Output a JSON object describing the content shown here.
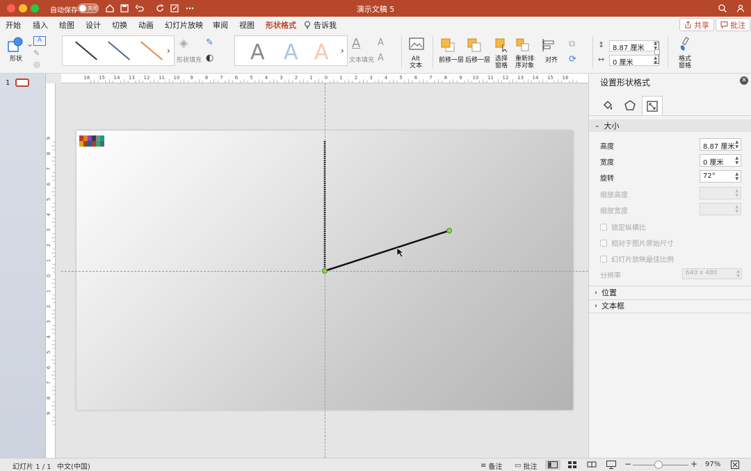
{
  "window": {
    "title": "演示文稿 5",
    "autosave_label": "自动保存",
    "autosave_state": "关闭"
  },
  "tabs": [
    "开始",
    "插入",
    "绘图",
    "设计",
    "切换",
    "动画",
    "幻灯片放映",
    "审阅",
    "视图",
    "形状格式",
    "告诉我"
  ],
  "active_tab": "形状格式",
  "share_label": "共享",
  "comment_label": "批注",
  "ribbon": {
    "shape_label": "形状",
    "shape_fill_label": "形状填充",
    "text_fill_label": "文本填充",
    "wordart_letter": "A",
    "alt_text_label": "Alt\n文本",
    "bring_forward_label": "前移一层",
    "send_backward_label": "后移一层",
    "selection_pane_label": "选择\n窗格",
    "reorder_label": "重新排\n序对象",
    "align_label": "对齐",
    "height_value": "8.87 厘米",
    "width_value": "0 厘米",
    "format_pane_label": "格式\n窗格"
  },
  "thumbnails": {
    "slide_number": "1"
  },
  "ruler": {
    "h_ticks": [
      "16",
      "15",
      "14",
      "13",
      "12",
      "11",
      "10",
      "9",
      "8",
      "7",
      "6",
      "5",
      "4",
      "3",
      "2",
      "1",
      "0",
      "1",
      "2",
      "3",
      "4",
      "5",
      "6",
      "7",
      "8",
      "9",
      "10",
      "11",
      "12",
      "13",
      "14",
      "15",
      "16"
    ],
    "v_ticks": [
      "9",
      "8",
      "7",
      "6",
      "5",
      "4",
      "3",
      "2",
      "1",
      "0",
      "1",
      "2",
      "3",
      "4",
      "5",
      "6",
      "7",
      "8",
      "9"
    ]
  },
  "format_panel": {
    "title": "设置形状格式",
    "size_section": "大小",
    "height_label": "高度",
    "height_value": "8.87 厘米",
    "width_label": "宽度",
    "width_value": "0 厘米",
    "rotation_label": "旋转",
    "rotation_value": "72°",
    "scale_height_label": "缩放高度",
    "scale_width_label": "缩放宽度",
    "lock_aspect_label": "锁定纵横比",
    "relative_original_label": "相对于图片原始尺寸",
    "best_scale_label": "幻灯片放映最佳比例",
    "resolution_label": "分辨率",
    "resolution_value": "640 x 480",
    "position_section": "位置",
    "textbox_section": "文本框"
  },
  "statusbar": {
    "slide_info": "幻灯片 1 / 1",
    "language": "中文(中国)",
    "notes_label": "备注",
    "comments_label": "批注",
    "zoom_percent": "97%"
  },
  "colors": {
    "accent": "#b7472a",
    "line": "#111111",
    "handle": "#8fd14f"
  }
}
